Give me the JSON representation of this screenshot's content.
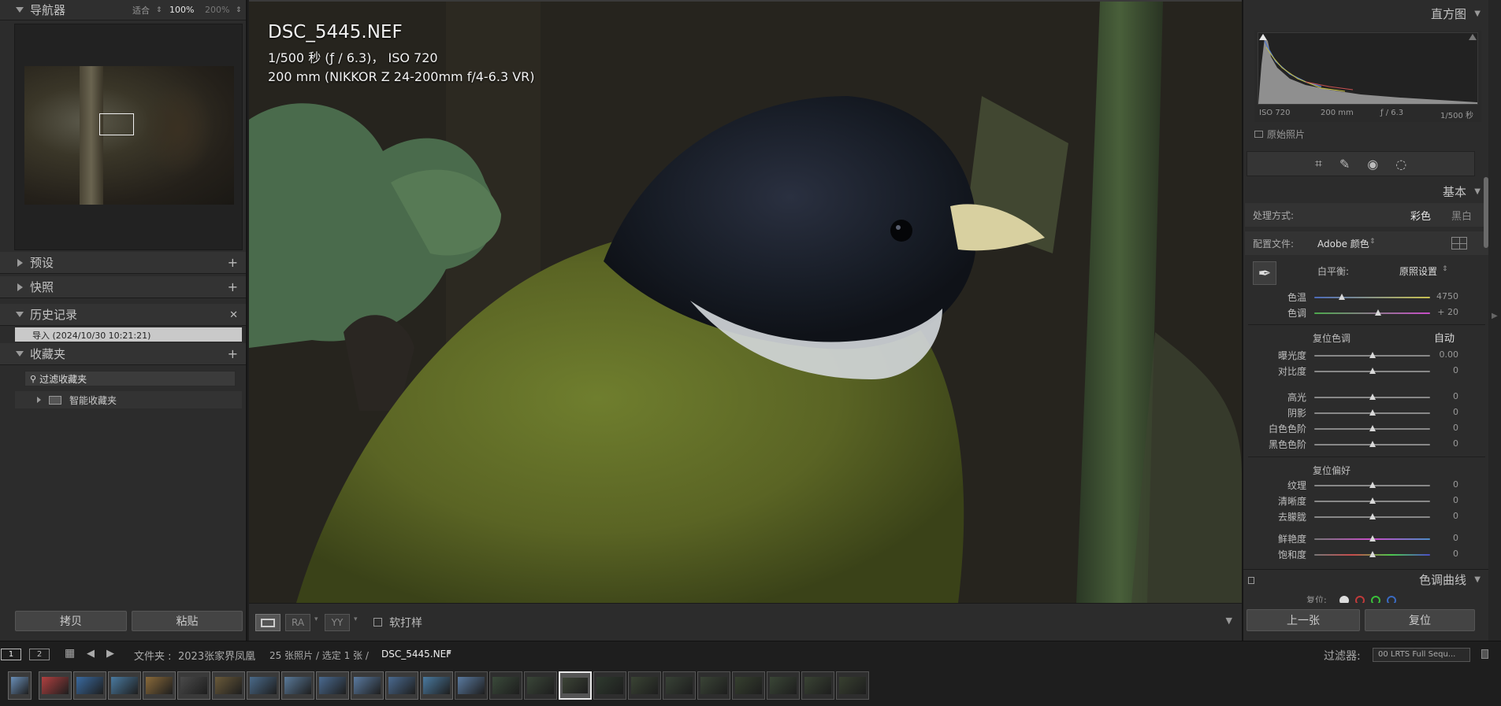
{
  "left": {
    "navigator": {
      "title": "导航器",
      "zoom_options": [
        "适合",
        "100%",
        "200%"
      ]
    },
    "panels": {
      "presets": "预设",
      "snapshots": "快照",
      "history": "历史记录",
      "history_item": "导入 (2024/10/30 10:21:21)",
      "collections": "收藏夹",
      "filter_label": "过滤收藏夹",
      "smart_collection": "智能收藏夹"
    },
    "buttons": {
      "copy": "拷贝",
      "paste": "粘贴"
    }
  },
  "photo": {
    "filename": "DSC_5445.NEF",
    "exposure_line": "1/500 秒 (ƒ / 6.3)， ISO 720",
    "lens_line": "200 mm (NIKKOR Z 24-200mm f/4-6.3 VR)"
  },
  "toolbar": {
    "soft_proof": "软打样",
    "ra": "RA",
    "yy": "YY"
  },
  "right": {
    "histogram": {
      "title": "直方图",
      "iso": "ISO 720",
      "focal": "200 mm",
      "aperture": "ƒ / 6.3",
      "shutter": "1/500 秒",
      "original_photo": "原始照片"
    },
    "basic": {
      "title": "基本",
      "treatment_label": "处理方式:",
      "treatment_color": "彩色",
      "treatment_bw": "黑白",
      "profile_label": "配置文件:",
      "profile_value": "Adobe 颜色",
      "wb_label": "白平衡:",
      "wb_value": "原照设置",
      "temp_label": "色温",
      "temp_value": "4750",
      "temp_pos": 0.24,
      "tint_label": "色调",
      "tint_value": "+ 20",
      "tint_pos": 0.55,
      "tone_reset": "复位色调",
      "auto": "自动",
      "exposure_label": "曝光度",
      "exposure_value": "0.00",
      "contrast_label": "对比度",
      "contrast_value": "0",
      "highlights_label": "高光",
      "highlights_value": "0",
      "shadows_label": "阴影",
      "shadows_value": "0",
      "whites_label": "白色色阶",
      "whites_value": "0",
      "blacks_label": "黑色色阶",
      "blacks_value": "0",
      "presence_reset": "复位偏好",
      "texture_label": "纹理",
      "texture_value": "0",
      "clarity_label": "清晰度",
      "clarity_value": "0",
      "dehaze_label": "去朦胧",
      "dehaze_value": "0",
      "vibrance_label": "鲜艳度",
      "vibrance_value": "0",
      "saturation_label": "饱和度",
      "saturation_value": "0"
    },
    "tone_curve": {
      "title": "色调曲线",
      "reset": "复位:"
    },
    "buttons": {
      "previous": "上一张",
      "reset": "复位"
    }
  },
  "filmstrip": {
    "page1": "1",
    "page2": "2",
    "folder_label": "文件夹 :",
    "folder_name": "2023张家界凤凰",
    "count_text": "25 张照片 / 选定 1 张 /",
    "current_file": "DSC_5445.NEF",
    "filter_label": "过滤器:",
    "filter_value": "00 LRTS Full Sequ...",
    "thumbnail_count": 25,
    "selected_index": 16
  },
  "colors": {
    "accent": "#ffffff",
    "panel": "#2c2c2c",
    "bird_body": "#6b7a2a",
    "bird_head": "#1e2430"
  }
}
